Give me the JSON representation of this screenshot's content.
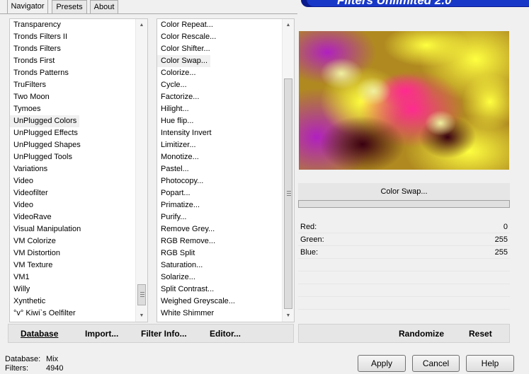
{
  "tabs": [
    "Navigator",
    "Presets",
    "About"
  ],
  "banner_title": "Filters Unlimited 2.0",
  "categories": [
    "Transparency",
    "Tronds Filters II",
    "Tronds Filters",
    "Tronds First",
    "Tronds Patterns",
    "TruFilters",
    "Two Moon",
    "Tymoes",
    "UnPlugged Colors",
    "UnPlugged Effects",
    "UnPlugged Shapes",
    "UnPlugged Tools",
    "Variations",
    "Video",
    "Videofilter",
    "Video",
    "VideoRave",
    "Visual Manipulation",
    "VM Colorize",
    "VM Distortion",
    "VM Texture",
    "VM1",
    "Willy",
    "Xynthetic",
    "°v° Kiwi`s Oelfilter"
  ],
  "selected_category": "UnPlugged Colors",
  "filters": [
    "Color Repeat...",
    "Color Rescale...",
    "Color Shifter...",
    "Color Swap...",
    "Colorize...",
    "Cycle...",
    "Factorize...",
    "Hilight...",
    "Hue flip...",
    "Intensity Invert",
    "Limitizer...",
    "Monotize...",
    "Pastel...",
    "Photocopy...",
    "Popart...",
    "Primatize...",
    "Purify...",
    "Remove Grey...",
    "RGB Remove...",
    "RGB Split",
    "Saturation...",
    "Solarize...",
    "Split Contrast...",
    "Weighed Greyscale...",
    "White Shimmer"
  ],
  "selected_filter": "Color Swap...",
  "bottom_links": {
    "database": "Database",
    "import": "Import...",
    "filter_info": "Filter Info...",
    "editor": "Editor..."
  },
  "current_filter": "Color Swap...",
  "params": [
    {
      "label": "Red:",
      "value": "0"
    },
    {
      "label": "Green:",
      "value": "255"
    },
    {
      "label": "Blue:",
      "value": "255"
    }
  ],
  "randomize": "Randomize",
  "reset": "Reset",
  "status": {
    "database_label": "Database:",
    "database_value": "Mix",
    "filters_label": "Filters:",
    "filters_value": "4940"
  },
  "buttons": {
    "apply": "Apply",
    "cancel": "Cancel",
    "help": "Help"
  },
  "colors": {
    "banner_dark": "#0a1a8c",
    "banner_light": "#1838c8",
    "selection": "#f0f0f0"
  }
}
